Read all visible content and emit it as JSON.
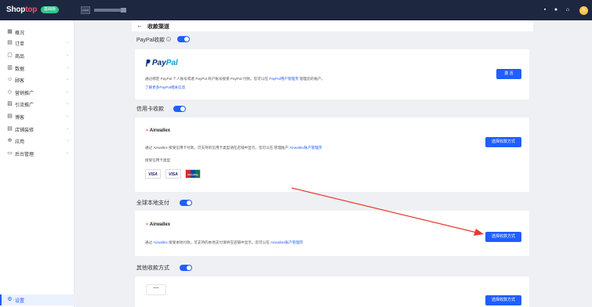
{
  "topbar": {
    "logo_shop": "Shop",
    "logo_top": "top",
    "badge": "基础版",
    "store_box": "LOGO",
    "icons": [
      "grid-icon",
      "help-icon",
      "home-icon"
    ],
    "avatar": "A"
  },
  "sidebar": {
    "items": [
      {
        "label": "概况",
        "icon": "▦",
        "arrow": ""
      },
      {
        "label": "订单",
        "icon": "▤",
        "arrow": "⌄"
      },
      {
        "label": "商品",
        "icon": "▢",
        "arrow": "⌄"
      },
      {
        "label": "数据",
        "icon": "▥",
        "arrow": "⌄"
      },
      {
        "label": "顾客",
        "icon": "☺",
        "arrow": "⌄"
      },
      {
        "label": "营销推广",
        "icon": "◇",
        "arrow": "⌄"
      },
      {
        "label": "引流推广",
        "icon": "▨",
        "arrow": "⌄"
      },
      {
        "label": "博客",
        "icon": "▤",
        "arrow": "⌄"
      },
      {
        "label": "店铺装修",
        "icon": "▤",
        "arrow": "⌄"
      },
      {
        "label": "应用",
        "icon": "⊕",
        "arrow": "⌄"
      },
      {
        "label": "后台管理",
        "icon": "▭",
        "arrow": "⌄"
      }
    ],
    "settings": {
      "label": "设置",
      "icon": "⚙"
    }
  },
  "header": {
    "back": "←",
    "title": "收款渠道"
  },
  "sections": {
    "paypal": {
      "title": "PayPal收款",
      "help": "?",
      "logo_p1": "Pay",
      "logo_p2": "Pal",
      "desc_1": "通过绑定 PayPal 个人账号或者 PayPal 商户账号接受 PayPal 付款。您可以在 ",
      "desc_link": "PayPal用户管理页",
      "desc_2": " 管理您的账户。",
      "more_link": "了解更多PayPal相关信息",
      "button": "激 活"
    },
    "credit": {
      "title": "信用卡收款",
      "logo": "Airwallex",
      "desc_1": "通过 Airwallex 接受信用卡付款。可支持的信用卡类型请在店铺中显示。您可以在 管理账户 ",
      "desc_link": "Airwallex账户管理页",
      "accepted_label": "接受信用卡类型",
      "cards": [
        "VISA",
        "VISA",
        "UnionPay"
      ],
      "button": "选择收款方式"
    },
    "local": {
      "title": "全球本地支付",
      "logo": "Airwallex",
      "desc_1": "通过 ",
      "desc_link1": "Airwallex",
      "desc_2": " 接受本地付款。可支持的本地支付请将在店铺中显示。您可以在 ",
      "desc_link2": "Airwallex账户管理页",
      "button": "选择收款方式"
    },
    "other": {
      "title": "其他收款方式",
      "dots": "···",
      "button": "选择收款方式"
    }
  },
  "colors": {
    "accent": "#1f5eff",
    "topbar": "#1e2740",
    "annotation_arrow": "#e8392f"
  }
}
